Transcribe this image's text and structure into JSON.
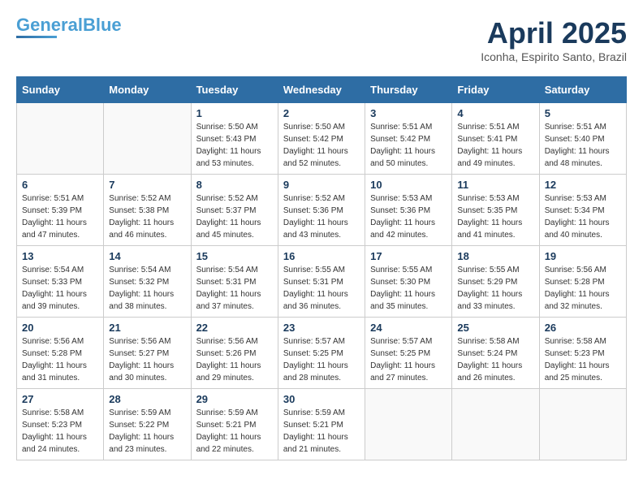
{
  "header": {
    "logo_general": "General",
    "logo_blue": "Blue",
    "title": "April 2025",
    "subtitle": "Iconha, Espirito Santo, Brazil"
  },
  "weekdays": [
    "Sunday",
    "Monday",
    "Tuesday",
    "Wednesday",
    "Thursday",
    "Friday",
    "Saturday"
  ],
  "weeks": [
    [
      {
        "day": "",
        "info": ""
      },
      {
        "day": "",
        "info": ""
      },
      {
        "day": "1",
        "info": "Sunrise: 5:50 AM\nSunset: 5:43 PM\nDaylight: 11 hours and 53 minutes."
      },
      {
        "day": "2",
        "info": "Sunrise: 5:50 AM\nSunset: 5:42 PM\nDaylight: 11 hours and 52 minutes."
      },
      {
        "day": "3",
        "info": "Sunrise: 5:51 AM\nSunset: 5:42 PM\nDaylight: 11 hours and 50 minutes."
      },
      {
        "day": "4",
        "info": "Sunrise: 5:51 AM\nSunset: 5:41 PM\nDaylight: 11 hours and 49 minutes."
      },
      {
        "day": "5",
        "info": "Sunrise: 5:51 AM\nSunset: 5:40 PM\nDaylight: 11 hours and 48 minutes."
      }
    ],
    [
      {
        "day": "6",
        "info": "Sunrise: 5:51 AM\nSunset: 5:39 PM\nDaylight: 11 hours and 47 minutes."
      },
      {
        "day": "7",
        "info": "Sunrise: 5:52 AM\nSunset: 5:38 PM\nDaylight: 11 hours and 46 minutes."
      },
      {
        "day": "8",
        "info": "Sunrise: 5:52 AM\nSunset: 5:37 PM\nDaylight: 11 hours and 45 minutes."
      },
      {
        "day": "9",
        "info": "Sunrise: 5:52 AM\nSunset: 5:36 PM\nDaylight: 11 hours and 43 minutes."
      },
      {
        "day": "10",
        "info": "Sunrise: 5:53 AM\nSunset: 5:36 PM\nDaylight: 11 hours and 42 minutes."
      },
      {
        "day": "11",
        "info": "Sunrise: 5:53 AM\nSunset: 5:35 PM\nDaylight: 11 hours and 41 minutes."
      },
      {
        "day": "12",
        "info": "Sunrise: 5:53 AM\nSunset: 5:34 PM\nDaylight: 11 hours and 40 minutes."
      }
    ],
    [
      {
        "day": "13",
        "info": "Sunrise: 5:54 AM\nSunset: 5:33 PM\nDaylight: 11 hours and 39 minutes."
      },
      {
        "day": "14",
        "info": "Sunrise: 5:54 AM\nSunset: 5:32 PM\nDaylight: 11 hours and 38 minutes."
      },
      {
        "day": "15",
        "info": "Sunrise: 5:54 AM\nSunset: 5:31 PM\nDaylight: 11 hours and 37 minutes."
      },
      {
        "day": "16",
        "info": "Sunrise: 5:55 AM\nSunset: 5:31 PM\nDaylight: 11 hours and 36 minutes."
      },
      {
        "day": "17",
        "info": "Sunrise: 5:55 AM\nSunset: 5:30 PM\nDaylight: 11 hours and 35 minutes."
      },
      {
        "day": "18",
        "info": "Sunrise: 5:55 AM\nSunset: 5:29 PM\nDaylight: 11 hours and 33 minutes."
      },
      {
        "day": "19",
        "info": "Sunrise: 5:56 AM\nSunset: 5:28 PM\nDaylight: 11 hours and 32 minutes."
      }
    ],
    [
      {
        "day": "20",
        "info": "Sunrise: 5:56 AM\nSunset: 5:28 PM\nDaylight: 11 hours and 31 minutes."
      },
      {
        "day": "21",
        "info": "Sunrise: 5:56 AM\nSunset: 5:27 PM\nDaylight: 11 hours and 30 minutes."
      },
      {
        "day": "22",
        "info": "Sunrise: 5:56 AM\nSunset: 5:26 PM\nDaylight: 11 hours and 29 minutes."
      },
      {
        "day": "23",
        "info": "Sunrise: 5:57 AM\nSunset: 5:25 PM\nDaylight: 11 hours and 28 minutes."
      },
      {
        "day": "24",
        "info": "Sunrise: 5:57 AM\nSunset: 5:25 PM\nDaylight: 11 hours and 27 minutes."
      },
      {
        "day": "25",
        "info": "Sunrise: 5:58 AM\nSunset: 5:24 PM\nDaylight: 11 hours and 26 minutes."
      },
      {
        "day": "26",
        "info": "Sunrise: 5:58 AM\nSunset: 5:23 PM\nDaylight: 11 hours and 25 minutes."
      }
    ],
    [
      {
        "day": "27",
        "info": "Sunrise: 5:58 AM\nSunset: 5:23 PM\nDaylight: 11 hours and 24 minutes."
      },
      {
        "day": "28",
        "info": "Sunrise: 5:59 AM\nSunset: 5:22 PM\nDaylight: 11 hours and 23 minutes."
      },
      {
        "day": "29",
        "info": "Sunrise: 5:59 AM\nSunset: 5:21 PM\nDaylight: 11 hours and 22 minutes."
      },
      {
        "day": "30",
        "info": "Sunrise: 5:59 AM\nSunset: 5:21 PM\nDaylight: 11 hours and 21 minutes."
      },
      {
        "day": "",
        "info": ""
      },
      {
        "day": "",
        "info": ""
      },
      {
        "day": "",
        "info": ""
      }
    ]
  ]
}
